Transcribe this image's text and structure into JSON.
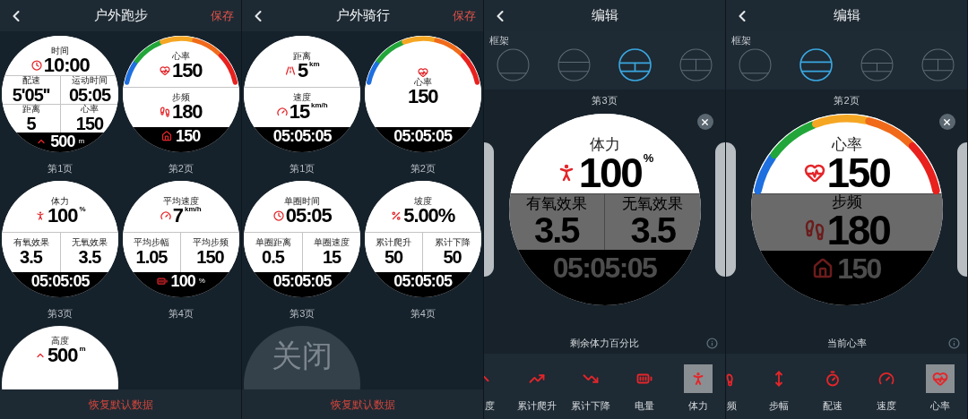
{
  "panels": [
    {
      "kind": "list",
      "title": "户外跑步",
      "save": "保存",
      "footer": "恢复默认数据",
      "pages": [
        {
          "kind": "face",
          "label": "第1页",
          "face": {
            "hr_arc": false,
            "rows": [
              {
                "kind": "main",
                "label": "时间",
                "value": "10:00"
              },
              {
                "kind": "split",
                "cells": [
                  {
                    "label": "配速",
                    "value": "5'05''"
                  },
                  {
                    "label": "运动时间",
                    "value": "05:05"
                  }
                ]
              },
              {
                "kind": "split",
                "cells": [
                  {
                    "label": "距离",
                    "value": "5"
                  },
                  {
                    "label": "心率",
                    "value": "150"
                  }
                ]
              },
              {
                "kind": "footer",
                "value": "500",
                "unit": "m"
              }
            ]
          }
        },
        {
          "kind": "face",
          "label": "第2页",
          "face": {
            "hr_arc": true,
            "rows": [
              {
                "kind": "main",
                "label": "心率",
                "value": "150"
              },
              {
                "kind": "main",
                "label": "步频",
                "value": "180"
              },
              {
                "kind": "footer",
                "value": "150"
              }
            ]
          }
        },
        {
          "kind": "face",
          "label": "第3页",
          "face": {
            "hr_arc": false,
            "rows": [
              {
                "kind": "main",
                "label": "体力",
                "value": "100",
                "unit": "%"
              },
              {
                "kind": "split",
                "cells": [
                  {
                    "label": "有氧效果",
                    "value": "3.5"
                  },
                  {
                    "label": "无氧效果",
                    "value": "3.5"
                  }
                ]
              },
              {
                "kind": "footer",
                "value": "05:05:05"
              }
            ]
          }
        },
        {
          "kind": "face",
          "label": "第4页",
          "face": {
            "hr_arc": false,
            "rows": [
              {
                "kind": "main",
                "label": "平均速度",
                "value": "7",
                "unit": "km/h"
              },
              {
                "kind": "split",
                "cells": [
                  {
                    "label": "平均步幅",
                    "value": "1.05"
                  },
                  {
                    "label": "平均步频",
                    "value": "150"
                  }
                ]
              },
              {
                "kind": "footer",
                "value": "100",
                "unit": "%"
              }
            ]
          }
        },
        {
          "kind": "face",
          "face": {
            "hr_arc": false,
            "rows": [
              {
                "kind": "main",
                "label": "高度",
                "value": "500",
                "unit": "m"
              }
            ]
          }
        }
      ]
    },
    {
      "kind": "list",
      "title": "户外骑行",
      "save": "保存",
      "footer": "恢复默认数据",
      "pages": [
        {
          "kind": "face",
          "label": "第1页",
          "face": {
            "hr_arc": false,
            "rows": [
              {
                "kind": "main",
                "label": "距离",
                "value": "5",
                "unit": "km"
              },
              {
                "kind": "main",
                "label": "速度",
                "value": "15",
                "unit": "km/h"
              },
              {
                "kind": "footer",
                "value": "05:05:05"
              }
            ]
          }
        },
        {
          "kind": "face",
          "label": "第2页",
          "face": {
            "hr_arc": true,
            "rows": [
              {
                "kind": "stacked",
                "label": "心率",
                "value": "150"
              },
              {
                "kind": "footer",
                "value": "05:05:05"
              }
            ]
          }
        },
        {
          "kind": "face",
          "label": "第3页",
          "face": {
            "hr_arc": false,
            "rows": [
              {
                "kind": "main",
                "label": "单圈时间",
                "value": "05:05"
              },
              {
                "kind": "split",
                "cells": [
                  {
                    "label": "单圈距离",
                    "value": "0.5"
                  },
                  {
                    "label": "单圈速度",
                    "value": "15"
                  }
                ]
              },
              {
                "kind": "footer",
                "value": "05:05:05"
              }
            ]
          }
        },
        {
          "kind": "face",
          "label": "第4页",
          "face": {
            "hr_arc": false,
            "rows": [
              {
                "kind": "main",
                "label": "坡度",
                "value": "5.00%"
              },
              {
                "kind": "split",
                "cells": [
                  {
                    "label": "累计爬升",
                    "value": "50"
                  },
                  {
                    "label": "累计下降",
                    "value": "50"
                  }
                ]
              },
              {
                "kind": "footer",
                "value": "05:05:05"
              }
            ]
          }
        },
        {
          "kind": "off",
          "text": "关闭"
        }
      ]
    },
    {
      "kind": "editor",
      "title": "编辑",
      "frames_label": "框架",
      "page_label": "第3页",
      "description": "剩余体力百分比",
      "frames": [
        {
          "kind": "single",
          "selected": false
        },
        {
          "kind": "double",
          "selected": false
        },
        {
          "kind": "split",
          "selected": true
        },
        {
          "kind": "grid",
          "selected": false
        }
      ],
      "face": {
        "hr_arc": false,
        "rows": [
          {
            "kind": "main",
            "label": "体力",
            "value": "100",
            "unit": "%",
            "active": true
          },
          {
            "kind": "split",
            "active": false,
            "cells": [
              {
                "label": "有氧效果",
                "value": "3.5"
              },
              {
                "label": "无氧效果",
                "value": "3.5"
              }
            ]
          },
          {
            "kind": "footer",
            "value": "05:05:05",
            "active": false
          }
        ]
      },
      "tools": [
        {
          "kind": "partial",
          "label": "度",
          "selected": false
        },
        {
          "kind": "full",
          "label": "累计爬升",
          "selected": false
        },
        {
          "kind": "full",
          "label": "累计下降",
          "selected": false
        },
        {
          "kind": "full",
          "label": "电量",
          "selected": false
        },
        {
          "kind": "full",
          "label": "体力",
          "selected": true
        }
      ]
    },
    {
      "kind": "editor",
      "title": "编辑",
      "frames_label": "框架",
      "page_label": "第2页",
      "description": "当前心率",
      "frames": [
        {
          "kind": "single",
          "selected": false
        },
        {
          "kind": "double",
          "selected": true
        },
        {
          "kind": "split",
          "selected": false
        },
        {
          "kind": "grid",
          "selected": false
        }
      ],
      "face": {
        "hr_arc": true,
        "rows": [
          {
            "kind": "main",
            "label": "心率",
            "value": "150",
            "active": true
          },
          {
            "kind": "main",
            "label": "步频",
            "value": "180",
            "active": false
          },
          {
            "kind": "footer",
            "value": "150",
            "active": false
          }
        ]
      },
      "tools": [
        {
          "kind": "partial",
          "label": "频",
          "selected": false
        },
        {
          "kind": "full",
          "label": "步幅",
          "selected": false
        },
        {
          "kind": "full",
          "label": "配速",
          "selected": false
        },
        {
          "kind": "full",
          "label": "速度",
          "selected": false
        },
        {
          "kind": "full",
          "label": "心率",
          "selected": true
        }
      ]
    }
  ]
}
